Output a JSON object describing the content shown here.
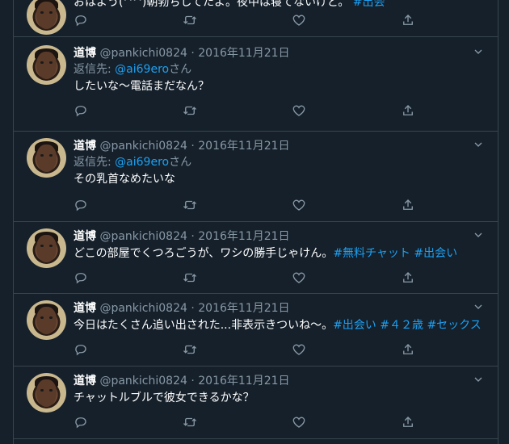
{
  "top_partial": {
    "text": "おはよう(^^)朝勃ちしてたよ。夜中は寝てないけど。",
    "tag": "#出会"
  },
  "tweets": [
    {
      "name": "道博",
      "handle": "@pankichi0824",
      "sep": "·",
      "date": "2016年11月21日",
      "reply_prefix": "返信先: ",
      "reply_to": "@ai69ero",
      "reply_suffix": "さん",
      "text": "したいな〜電話まだなん？",
      "tags": ""
    },
    {
      "name": "道博",
      "handle": "@pankichi0824",
      "sep": "·",
      "date": "2016年11月21日",
      "reply_prefix": "返信先: ",
      "reply_to": "@ai69ero",
      "reply_suffix": "さん",
      "text": "その乳首なめたいな",
      "tags": ""
    },
    {
      "name": "道博",
      "handle": "@pankichi0824",
      "sep": "·",
      "date": "2016年11月21日",
      "text": "どこの部屋でくつろごうが、ワシの勝手じゃけん。",
      "tags": "#無料チャット #出会い"
    },
    {
      "name": "道博",
      "handle": "@pankichi0824",
      "sep": "·",
      "date": "2016年11月21日",
      "text": "今日はたくさん追い出された...非表示きついね〜。",
      "tags": "#出会い #４２歳 #セックス"
    },
    {
      "name": "道博",
      "handle": "@pankichi0824",
      "sep": "·",
      "date": "2016年11月21日",
      "text": "チャットルブルで彼女できるかな？",
      "tags": ""
    }
  ],
  "icons": {
    "reply": "reply-icon",
    "retweet": "retweet-icon",
    "like": "heart-icon",
    "share": "share-icon",
    "more": "chevron-down-icon"
  },
  "colors": {
    "background": "#15202b",
    "border": "#38444d",
    "secondary_text": "#8899a6",
    "accent": "#1da1f2"
  }
}
